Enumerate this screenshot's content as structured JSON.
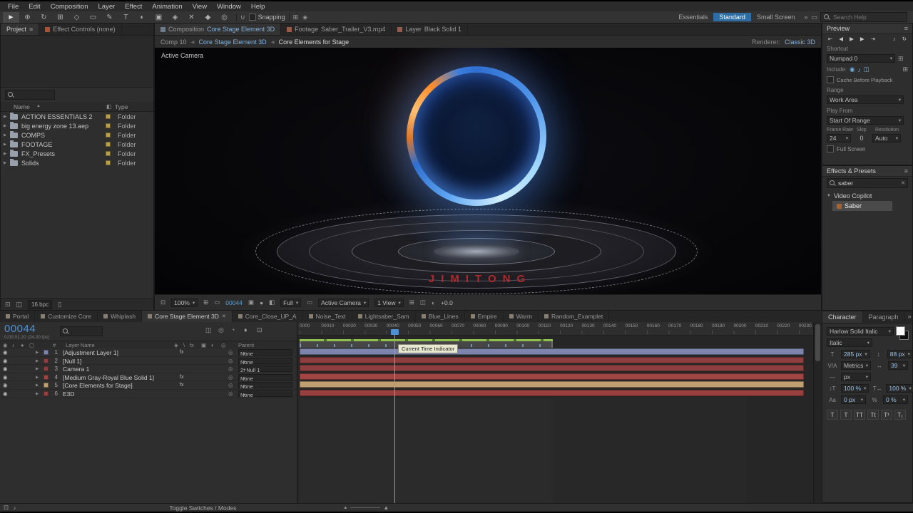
{
  "icons": {
    "menu": "≡",
    "chevrons": "»",
    "dd": "▾",
    "close": "✕",
    "sort": "▲",
    "tri": "▶",
    "tridown": "▼",
    "eye": "◉",
    "audio": "♪",
    "solo": "●",
    "lock": "▢",
    "pickwhip": "◎",
    "first": "⇤",
    "prev": "◀",
    "play": "▶",
    "next": "▶",
    "last": "⇥",
    "mute": "♪",
    "loop": "↻",
    "grid": "⊞",
    "mask": "▭",
    "snapshot": "▣",
    "channels": "◧",
    "region": "⊡",
    "flow": "◫",
    "graph": "♦",
    "blur": "◔",
    "blend": "◐",
    "cube": "◈",
    "draft": "◎",
    "monitor": "▭",
    "trash": "▯",
    "magnet": "∪",
    "slash": "\\",
    "fx": "fx",
    "mtn-s": "▲",
    "mtn-b": "▲",
    "tag": "◧"
  },
  "menubar": {
    "items": [
      "File",
      "Edit",
      "Composition",
      "Layer",
      "Effect",
      "Animation",
      "View",
      "Window",
      "Help"
    ]
  },
  "toolbar": {
    "tools": [
      {
        "glyph": "►",
        "name": "selection"
      },
      {
        "glyph": "⊕",
        "name": "zoom"
      },
      {
        "glyph": "↻",
        "name": "orbit"
      },
      {
        "glyph": "⊞",
        "name": "pan-camera"
      },
      {
        "glyph": "◇",
        "name": "dolly"
      },
      {
        "glyph": "▭",
        "name": "rectangle"
      },
      {
        "glyph": "✎",
        "name": "pen"
      },
      {
        "glyph": "T",
        "name": "type"
      },
      {
        "glyph": "◐",
        "name": "brush"
      },
      {
        "glyph": "▣",
        "name": "clone-stamp"
      },
      {
        "glyph": "◈",
        "name": "eraser"
      },
      {
        "glyph": "✕",
        "name": "roto-brush"
      },
      {
        "glyph": "◆",
        "name": "puppet"
      },
      {
        "glyph": "◎",
        "name": "shape"
      }
    ],
    "snapping": "Snapping",
    "workspaces": [
      {
        "label": "Essentials",
        "active": false
      },
      {
        "label": "Standard",
        "active": true
      },
      {
        "label": "Small Screen",
        "active": false
      }
    ],
    "search_placeholder": "Search Help"
  },
  "project": {
    "tabs": [
      {
        "label": "Project"
      },
      {
        "label": "Effect Controls (none)"
      }
    ],
    "columns": {
      "name": "Name",
      "type": "Type"
    },
    "rows": [
      {
        "name": "ACTION ESSENTIALS 2",
        "type": "Folder"
      },
      {
        "name": "big energy zone 13.aep",
        "type": "Folder"
      },
      {
        "name": "COMPS",
        "type": "Folder"
      },
      {
        "name": "FOOTAGE",
        "type": "Folder"
      },
      {
        "name": "FX_Presets",
        "type": "Folder"
      },
      {
        "name": "Solids",
        "type": "Folder"
      }
    ],
    "bpc": "16 bpc"
  },
  "comp": {
    "tabs": [
      {
        "kind": "Composition",
        "name": "Core Stage Element 3D",
        "active": true,
        "icon_color": "#6b7d8f"
      },
      {
        "kind": "Footage",
        "name": "Saber_Trailer_V3.mp4",
        "active": false,
        "icon_color": "#9a5a4a"
      },
      {
        "kind": "Layer",
        "name": "Black Solid 1",
        "active": false,
        "icon_color": "#9a5a4a"
      }
    ],
    "breadcrumb": {
      "a": "Comp 10",
      "b": "Core Stage Element 3D",
      "c": "Core Elements for Stage"
    },
    "renderer_label": "Renderer:",
    "renderer": "Classic 3D",
    "view_label": "Active Camera",
    "watermark": "JIMITONG",
    "footer": {
      "zoom": "100%",
      "timecode": "00044",
      "resolution": "Full",
      "camera": "Active Camera",
      "views": "1 View",
      "exposure": "+0.0"
    }
  },
  "preview": {
    "title": "Preview",
    "transport": [
      {
        "glyph": "⇤",
        "name": "first-frame"
      },
      {
        "glyph": "◀",
        "name": "previous-frame"
      },
      {
        "glyph": "▶",
        "name": "play"
      },
      {
        "glyph": "▶",
        "name": "next-frame"
      },
      {
        "glyph": "⇥",
        "name": "last-frame"
      }
    ],
    "shortcut_label": "Shortcut",
    "shortcut": "Numpad 0",
    "include_label": "Include:",
    "cache_label": "Cache Before Playback",
    "range_label": "Range",
    "range": "Work Area",
    "play_from_label": "Play From",
    "play_from": "Start Of Range",
    "frame_rate_label": "Frame Rate",
    "skip_label": "Skip",
    "resolution_label": "Resolution",
    "frame_rate": "24",
    "skip": "0",
    "resolution": "Auto",
    "full_screen_label": "Full Screen"
  },
  "effects": {
    "title": "Effects & Presets",
    "search_value": "saber",
    "group": "Video Copilot",
    "item": "Saber"
  },
  "character": {
    "tabs": [
      {
        "label": "Character",
        "active": true
      },
      {
        "label": "Paragraph",
        "active": false
      }
    ],
    "font": "Harlow Solid Italic",
    "style": "Italic",
    "size": "285 px",
    "leading": "88 px",
    "kerning": "Metrics",
    "tracking": "39",
    "stroke": "px",
    "vscale": "100 %",
    "hscale": "100 %",
    "baseline": "0 px",
    "tsume": "0 %",
    "style_buttons": [
      "T",
      "T",
      "TT",
      "Tt",
      "T¹",
      "T₁"
    ]
  },
  "timeline": {
    "tabs": [
      {
        "label": "Portal",
        "active": false
      },
      {
        "label": "Customize Core",
        "active": false
      },
      {
        "label": "Whiplash",
        "active": false
      },
      {
        "label": "Core Stage Element 3D",
        "active": true
      },
      {
        "label": "Core_Close_UP_A",
        "active": false
      },
      {
        "label": "Noise_Text",
        "active": false
      },
      {
        "label": "Lightsaber_Sam",
        "active": false
      },
      {
        "label": "Blue_Lines",
        "active": false
      },
      {
        "label": "Empire",
        "active": false
      },
      {
        "label": "Warm",
        "active": false
      },
      {
        "label": "Random_Examplet",
        "active": false
      }
    ],
    "timecode": "00044",
    "subtime": "0;00;01;20 (24.00 fps)",
    "columns": {
      "number": "#",
      "layer_name": "Layer Name",
      "parent": "Parent"
    },
    "ruler": [
      "0000",
      "00010",
      "00020",
      "00030",
      "00040",
      "00050",
      "00060",
      "00070",
      "00080",
      "00090",
      "00100",
      "00110",
      "00120",
      "00130",
      "00140",
      "00150",
      "00160",
      "00170",
      "00180",
      "00190",
      "00200",
      "00210",
      "00220",
      "00230"
    ],
    "cti_tooltip": "Current Time Indicator",
    "layers": [
      {
        "num": "1",
        "name": "[Adjustment Layer 1]",
        "parent": "None",
        "color": "#7d84ae",
        "fx": "fx"
      },
      {
        "num": "2",
        "name": "[Null 1]",
        "parent": "None",
        "color": "#8e3e3e",
        "fx": ""
      },
      {
        "num": "3",
        "name": "Camera 1",
        "parent": "2. Null 1",
        "color": "#8e3e3e",
        "fx": ""
      },
      {
        "num": "4",
        "name": "[Medium Gray-Royal Blue Solid 1]",
        "parent": "None",
        "color": "#a04444",
        "fx": "fx"
      },
      {
        "num": "5",
        "name": "[Core Elements for Stage]",
        "parent": "None",
        "color": "#c0a070",
        "fx": "fx"
      },
      {
        "num": "6",
        "name": "E3D",
        "parent": "None",
        "color": "#984040",
        "fx": ""
      }
    ]
  },
  "statusbar": {
    "toggle_label": "Toggle Switches / Modes"
  }
}
